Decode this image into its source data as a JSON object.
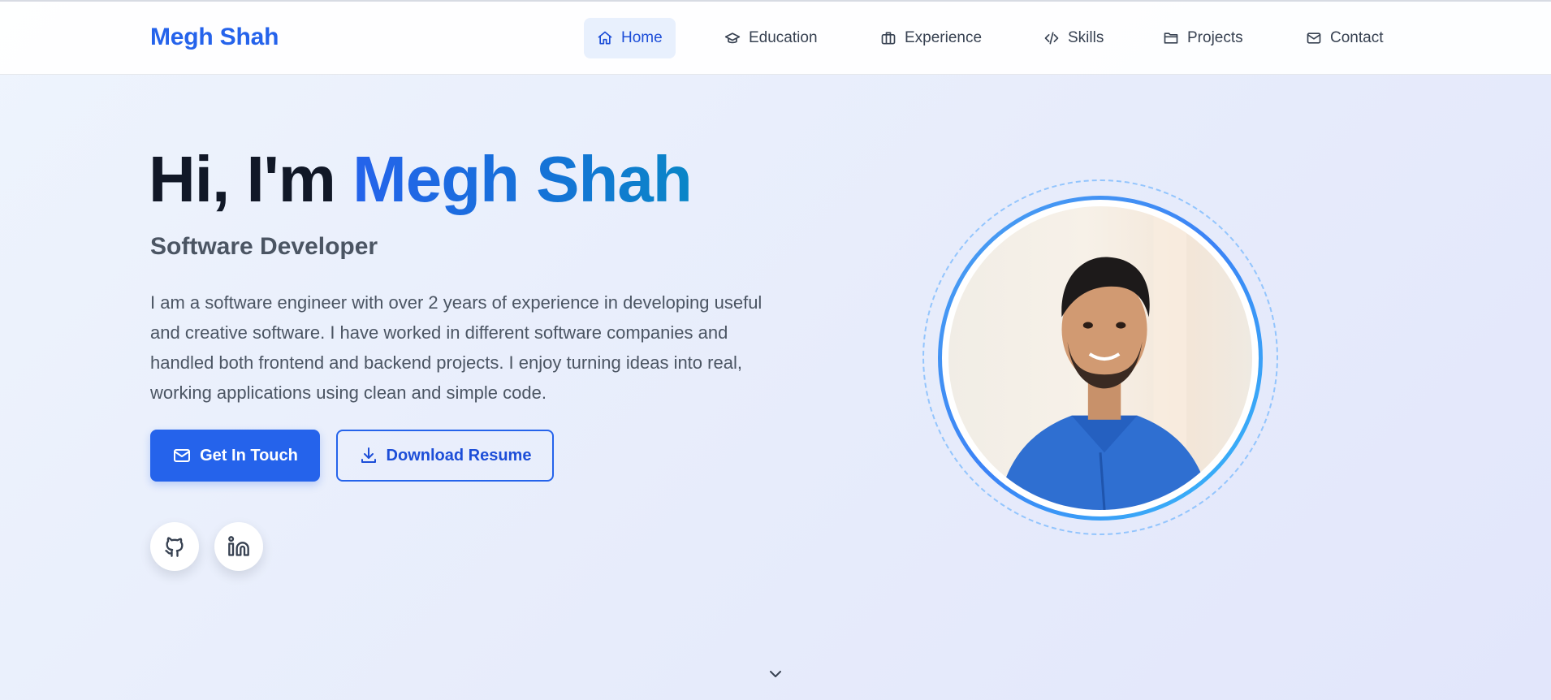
{
  "brand": "Megh Shah",
  "nav": {
    "home": "Home",
    "education": "Education",
    "experience": "Experience",
    "skills": "Skills",
    "projects": "Projects",
    "contact": "Contact",
    "active": "Home"
  },
  "hero": {
    "greeting": "Hi, I'm",
    "name": "Megh Shah",
    "role": "Software Developer",
    "about": "I am a software engineer with over 2 years of experience in developing useful and creative software. I have worked in different software companies and handled both frontend and backend projects. I enjoy turning ideas into real, working applications using clean and simple code.",
    "primary_button": "Get In Touch",
    "secondary_button": "Download Resume"
  },
  "icons": {
    "home": "home-icon",
    "education": "graduation-cap-icon",
    "experience": "briefcase-icon",
    "skills": "code-icon",
    "projects": "folder-icon",
    "contact": "mail-icon",
    "primary_button": "mail-icon",
    "secondary_button": "download-icon",
    "social": [
      "github-icon",
      "linkedin-icon"
    ],
    "scroll": "chevron-down-icon"
  },
  "colors": {
    "accent": "#2563eb",
    "nav_active_bg": "#e8f0fd",
    "heading": "#111827",
    "body_text": "#4b5563"
  }
}
